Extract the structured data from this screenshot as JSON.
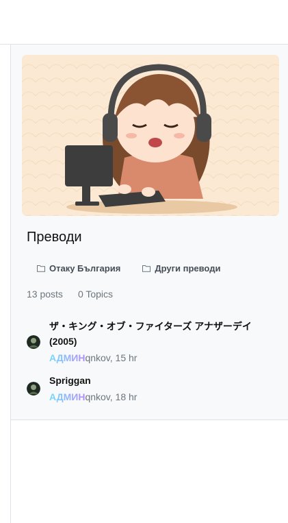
{
  "category": {
    "title": "Преводи",
    "subcategories": [
      {
        "label": "Отаку България",
        "icon": "folder-icon"
      },
      {
        "label": "Други преводи",
        "icon": "folder-icon"
      }
    ],
    "stats": {
      "posts": "13 posts",
      "topics": "0 Topics"
    }
  },
  "recent_posts": [
    {
      "title": "ザ・キング・オブ・ファイターズ アナザーデイ (2005)",
      "badge": "АДМИН",
      "author": "qnkov",
      "time": ", 15 hr"
    },
    {
      "title": "Spriggan",
      "badge": "АДМИН",
      "author": "qnkov",
      "time": ", 18 hr"
    }
  ],
  "colors": {
    "badge_gradient_start": "#6fdcff",
    "badge_gradient_end": "#b38cff",
    "card_bg": "#f8f9fa",
    "banner_bg": "#fbe9d3"
  }
}
